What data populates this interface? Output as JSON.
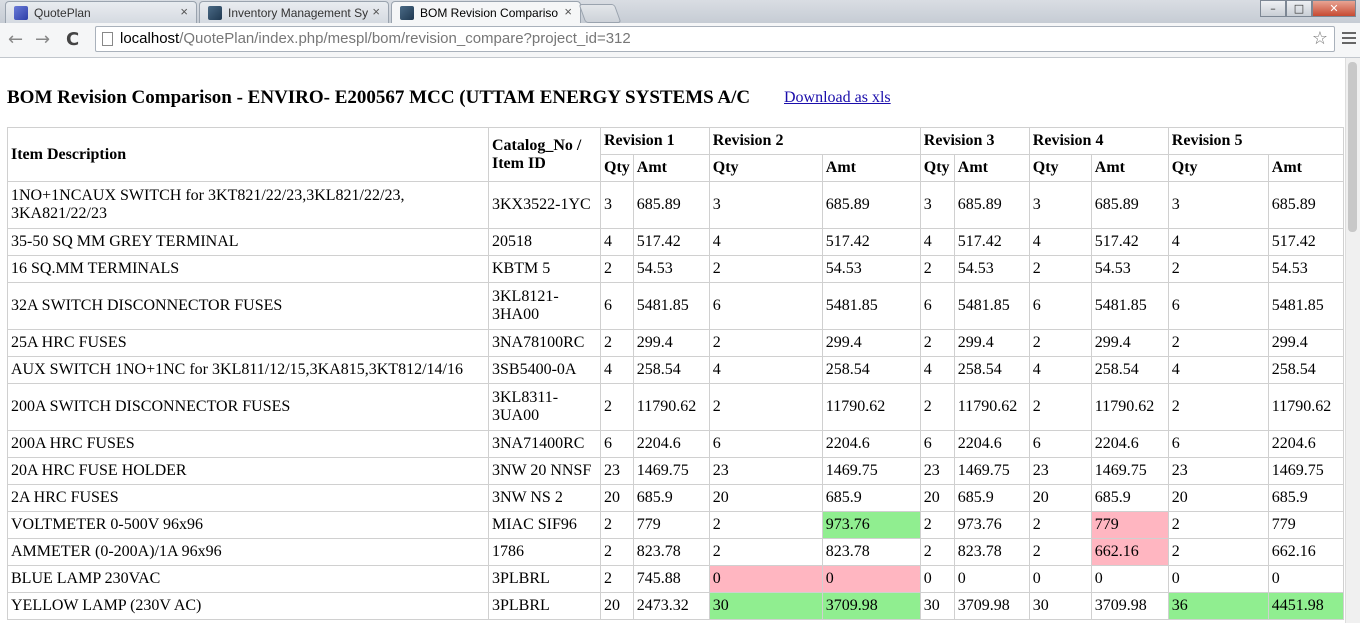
{
  "browser": {
    "tabs": [
      {
        "title": "QuotePlan",
        "close": "×"
      },
      {
        "title": "Inventory Management Sy",
        "close": "×"
      },
      {
        "title": "BOM Revision Compariso",
        "close": "×"
      }
    ],
    "url_host": "localhost",
    "url_path": "/QuotePlan/index.php/mespl/bom/revision_compare?project_id=312",
    "back": "←",
    "forward": "→",
    "reload": "C",
    "star": "☆",
    "win_min": "–",
    "win_max": "□",
    "win_close": "✕"
  },
  "page": {
    "title": "BOM Revision Comparison - ENVIRO- E200567 MCC (UTTAM ENERGY SYSTEMS A/C",
    "download_label": "Download as xls",
    "headers": {
      "item_description": "Item Description",
      "catalog": "Catalog_No / Item ID",
      "revisions": [
        "Revision 1",
        "Revision 2",
        "Revision 3",
        "Revision 4",
        "Revision 5"
      ],
      "qty": "Qty",
      "amt": "Amt"
    },
    "rows": [
      {
        "desc": "1NO+1NCAUX SWITCH for 3KT821/22/23,3KL821/22/23, 3KA821/22/23",
        "cat": "3KX3522-1YC",
        "tall": true,
        "revs": [
          [
            "3",
            "685.89"
          ],
          [
            "3",
            "685.89"
          ],
          [
            "3",
            "685.89"
          ],
          [
            "3",
            "685.89"
          ],
          [
            "3",
            "685.89"
          ]
        ],
        "hl": [
          [
            "",
            ""
          ],
          [
            "",
            ""
          ],
          [
            "",
            ""
          ],
          [
            "",
            ""
          ],
          [
            "",
            ""
          ]
        ]
      },
      {
        "desc": "35-50 SQ MM GREY TERMINAL",
        "cat": "20518",
        "tall": false,
        "revs": [
          [
            "4",
            "517.42"
          ],
          [
            "4",
            "517.42"
          ],
          [
            "4",
            "517.42"
          ],
          [
            "4",
            "517.42"
          ],
          [
            "4",
            "517.42"
          ]
        ],
        "hl": [
          [
            "",
            ""
          ],
          [
            "",
            ""
          ],
          [
            "",
            ""
          ],
          [
            "",
            ""
          ],
          [
            "",
            ""
          ]
        ]
      },
      {
        "desc": "16 SQ.MM TERMINALS",
        "cat": "KBTM 5",
        "tall": false,
        "revs": [
          [
            "2",
            "54.53"
          ],
          [
            "2",
            "54.53"
          ],
          [
            "2",
            "54.53"
          ],
          [
            "2",
            "54.53"
          ],
          [
            "2",
            "54.53"
          ]
        ],
        "hl": [
          [
            "",
            ""
          ],
          [
            "",
            ""
          ],
          [
            "",
            ""
          ],
          [
            "",
            ""
          ],
          [
            "",
            ""
          ]
        ]
      },
      {
        "desc": "32A SWITCH DISCONNECTOR FUSES",
        "cat": "3KL8121-3HA00",
        "tall": true,
        "revs": [
          [
            "6",
            "5481.85"
          ],
          [
            "6",
            "5481.85"
          ],
          [
            "6",
            "5481.85"
          ],
          [
            "6",
            "5481.85"
          ],
          [
            "6",
            "5481.85"
          ]
        ],
        "hl": [
          [
            "",
            ""
          ],
          [
            "",
            ""
          ],
          [
            "",
            ""
          ],
          [
            "",
            ""
          ],
          [
            "",
            ""
          ]
        ]
      },
      {
        "desc": "25A HRC FUSES",
        "cat": "3NA78100RC",
        "tall": false,
        "revs": [
          [
            "2",
            "299.4"
          ],
          [
            "2",
            "299.4"
          ],
          [
            "2",
            "299.4"
          ],
          [
            "2",
            "299.4"
          ],
          [
            "2",
            "299.4"
          ]
        ],
        "hl": [
          [
            "",
            ""
          ],
          [
            "",
            ""
          ],
          [
            "",
            ""
          ],
          [
            "",
            ""
          ],
          [
            "",
            ""
          ]
        ]
      },
      {
        "desc": "AUX SWITCH 1NO+1NC for 3KL811/12/15,3KA815,3KT812/14/16",
        "cat": "3SB5400-0A",
        "tall": false,
        "revs": [
          [
            "4",
            "258.54"
          ],
          [
            "4",
            "258.54"
          ],
          [
            "4",
            "258.54"
          ],
          [
            "4",
            "258.54"
          ],
          [
            "4",
            "258.54"
          ]
        ],
        "hl": [
          [
            "",
            ""
          ],
          [
            "",
            ""
          ],
          [
            "",
            ""
          ],
          [
            "",
            ""
          ],
          [
            "",
            ""
          ]
        ]
      },
      {
        "desc": "200A SWITCH DISCONNECTOR FUSES",
        "cat": "3KL8311-3UA00",
        "tall": true,
        "revs": [
          [
            "2",
            "11790.62"
          ],
          [
            "2",
            "11790.62"
          ],
          [
            "2",
            "11790.62"
          ],
          [
            "2",
            "11790.62"
          ],
          [
            "2",
            "11790.62"
          ]
        ],
        "hl": [
          [
            "",
            ""
          ],
          [
            "",
            ""
          ],
          [
            "",
            ""
          ],
          [
            "",
            ""
          ],
          [
            "",
            ""
          ]
        ]
      },
      {
        "desc": "200A HRC FUSES",
        "cat": "3NA71400RC",
        "tall": false,
        "revs": [
          [
            "6",
            "2204.6"
          ],
          [
            "6",
            "2204.6"
          ],
          [
            "6",
            "2204.6"
          ],
          [
            "6",
            "2204.6"
          ],
          [
            "6",
            "2204.6"
          ]
        ],
        "hl": [
          [
            "",
            ""
          ],
          [
            "",
            ""
          ],
          [
            "",
            ""
          ],
          [
            "",
            ""
          ],
          [
            "",
            ""
          ]
        ]
      },
      {
        "desc": "20A HRC FUSE HOLDER",
        "cat": "3NW 20 NNSF",
        "tall": false,
        "revs": [
          [
            "23",
            "1469.75"
          ],
          [
            "23",
            "1469.75"
          ],
          [
            "23",
            "1469.75"
          ],
          [
            "23",
            "1469.75"
          ],
          [
            "23",
            "1469.75"
          ]
        ],
        "hl": [
          [
            "",
            ""
          ],
          [
            "",
            ""
          ],
          [
            "",
            ""
          ],
          [
            "",
            ""
          ],
          [
            "",
            ""
          ]
        ]
      },
      {
        "desc": "2A HRC FUSES",
        "cat": "3NW NS 2",
        "tall": false,
        "revs": [
          [
            "20",
            "685.9"
          ],
          [
            "20",
            "685.9"
          ],
          [
            "20",
            "685.9"
          ],
          [
            "20",
            "685.9"
          ],
          [
            "20",
            "685.9"
          ]
        ],
        "hl": [
          [
            "",
            ""
          ],
          [
            "",
            ""
          ],
          [
            "",
            ""
          ],
          [
            "",
            ""
          ],
          [
            "",
            ""
          ]
        ]
      },
      {
        "desc": "VOLTMETER 0-500V 96x96",
        "cat": "MIAC SIF96",
        "tall": false,
        "revs": [
          [
            "2",
            "779"
          ],
          [
            "2",
            "973.76"
          ],
          [
            "2",
            "973.76"
          ],
          [
            "2",
            "779"
          ],
          [
            "2",
            "779"
          ]
        ],
        "hl": [
          [
            "",
            ""
          ],
          [
            "",
            "g"
          ],
          [
            "",
            ""
          ],
          [
            "",
            "p"
          ],
          [
            "",
            ""
          ]
        ]
      },
      {
        "desc": "AMMETER (0-200A)/1A 96x96",
        "cat": "1786",
        "tall": false,
        "revs": [
          [
            "2",
            "823.78"
          ],
          [
            "2",
            "823.78"
          ],
          [
            "2",
            "823.78"
          ],
          [
            "2",
            "662.16"
          ],
          [
            "2",
            "662.16"
          ]
        ],
        "hl": [
          [
            "",
            ""
          ],
          [
            "",
            ""
          ],
          [
            "",
            ""
          ],
          [
            "",
            "p"
          ],
          [
            "",
            ""
          ]
        ]
      },
      {
        "desc": "BLUE LAMP 230VAC",
        "cat": "3PLBRL",
        "tall": false,
        "revs": [
          [
            "2",
            "745.88"
          ],
          [
            "0",
            "0"
          ],
          [
            "0",
            "0"
          ],
          [
            "0",
            "0"
          ],
          [
            "0",
            "0"
          ]
        ],
        "hl": [
          [
            "",
            ""
          ],
          [
            "p",
            "p"
          ],
          [
            "",
            ""
          ],
          [
            "",
            ""
          ],
          [
            "",
            ""
          ]
        ]
      },
      {
        "desc": "YELLOW LAMP (230V AC)",
        "cat": "3PLBRL",
        "tall": false,
        "revs": [
          [
            "20",
            "2473.32"
          ],
          [
            "30",
            "3709.98"
          ],
          [
            "30",
            "3709.98"
          ],
          [
            "30",
            "3709.98"
          ],
          [
            "36",
            "4451.98"
          ]
        ],
        "hl": [
          [
            "",
            ""
          ],
          [
            "g",
            "g"
          ],
          [
            "",
            ""
          ],
          [
            "",
            ""
          ],
          [
            "g",
            "g"
          ]
        ]
      }
    ]
  },
  "colors": {
    "increase": "#90ee90",
    "decrease": "#ffb6c1",
    "link": "#1a0dab"
  }
}
